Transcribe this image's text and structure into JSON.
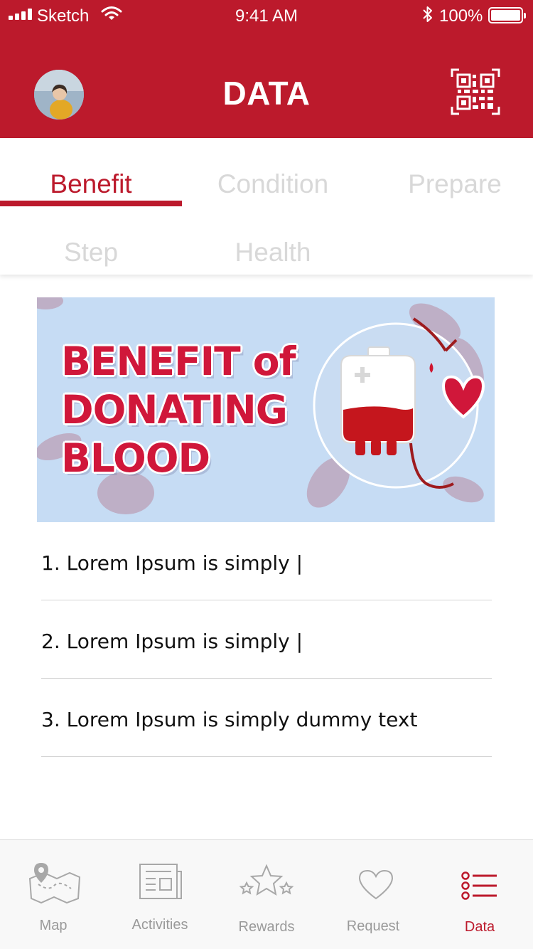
{
  "status_bar": {
    "carrier": "Sketch",
    "time": "9:41 AM",
    "battery": "100%"
  },
  "header": {
    "title": "DATA",
    "avatar_icon": "user-avatar",
    "qr_icon": "qr-code-icon"
  },
  "tabs": [
    {
      "label": "Benefit",
      "active": true
    },
    {
      "label": "Condition",
      "active": false
    },
    {
      "label": "Prepare",
      "active": false
    },
    {
      "label": "Step",
      "active": false
    },
    {
      "label": "Health",
      "active": false
    }
  ],
  "banner": {
    "line1": "BENEFIT of",
    "line2": "DONATING",
    "line3": "BLOOD"
  },
  "list": [
    "1. Lorem Ipsum is simply |",
    "2. Lorem Ipsum is simply |",
    "3. Lorem Ipsum is simply dummy text"
  ],
  "bottom_nav": [
    {
      "label": "Map",
      "icon": "map-icon",
      "active": false
    },
    {
      "label": "Activities",
      "icon": "newspaper-icon",
      "active": false
    },
    {
      "label": "Rewards",
      "icon": "stars-icon",
      "active": false
    },
    {
      "label": "Request",
      "icon": "heart-icon",
      "active": false
    },
    {
      "label": "Data",
      "icon": "list-icon",
      "active": true
    }
  ],
  "colors": {
    "brand_red": "#bc1a2c",
    "inactive_gray": "#d8d8d8",
    "banner_bg": "#c6dcf4"
  }
}
